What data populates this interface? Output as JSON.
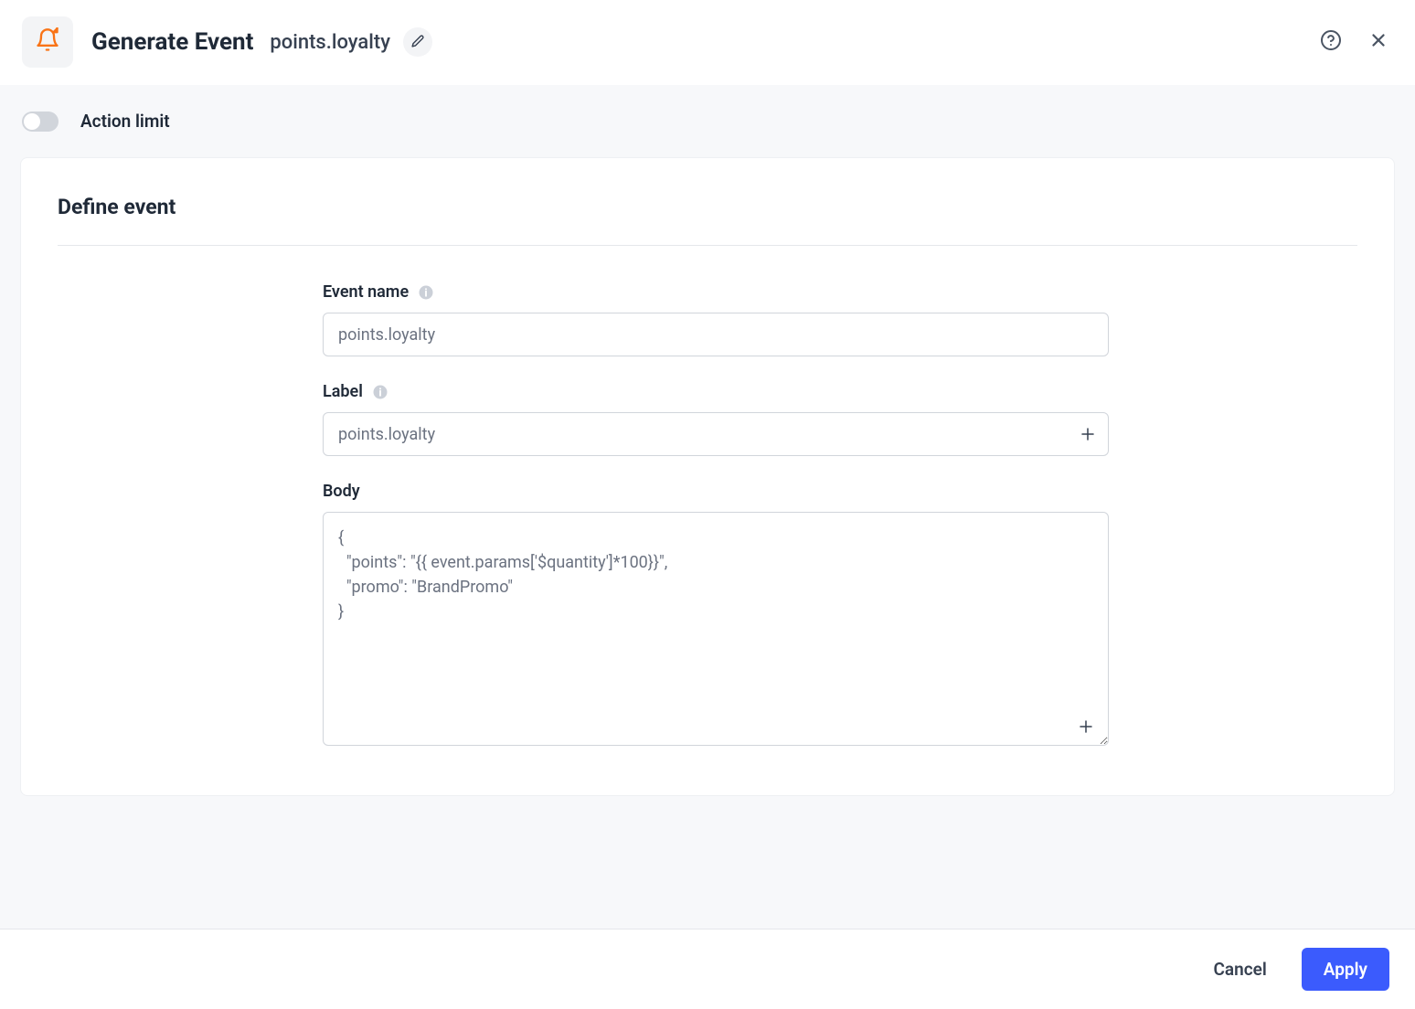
{
  "header": {
    "title": "Generate Event",
    "subtitle": "points.loyalty",
    "icon": "bell-arrow-icon",
    "accent_color": "#f97316"
  },
  "action_limit": {
    "label": "Action limit",
    "enabled": false
  },
  "card": {
    "title": "Define event"
  },
  "form": {
    "event_name": {
      "label": "Event name",
      "value": "points.loyalty"
    },
    "label_field": {
      "label": "Label",
      "value": "points.loyalty"
    },
    "body": {
      "label": "Body",
      "value": "{\n  \"points\": \"{{ event.params['$quantity']*100}}\",\n  \"promo\": \"BrandPromo\"\n}"
    }
  },
  "footer": {
    "cancel": "Cancel",
    "apply": "Apply"
  }
}
